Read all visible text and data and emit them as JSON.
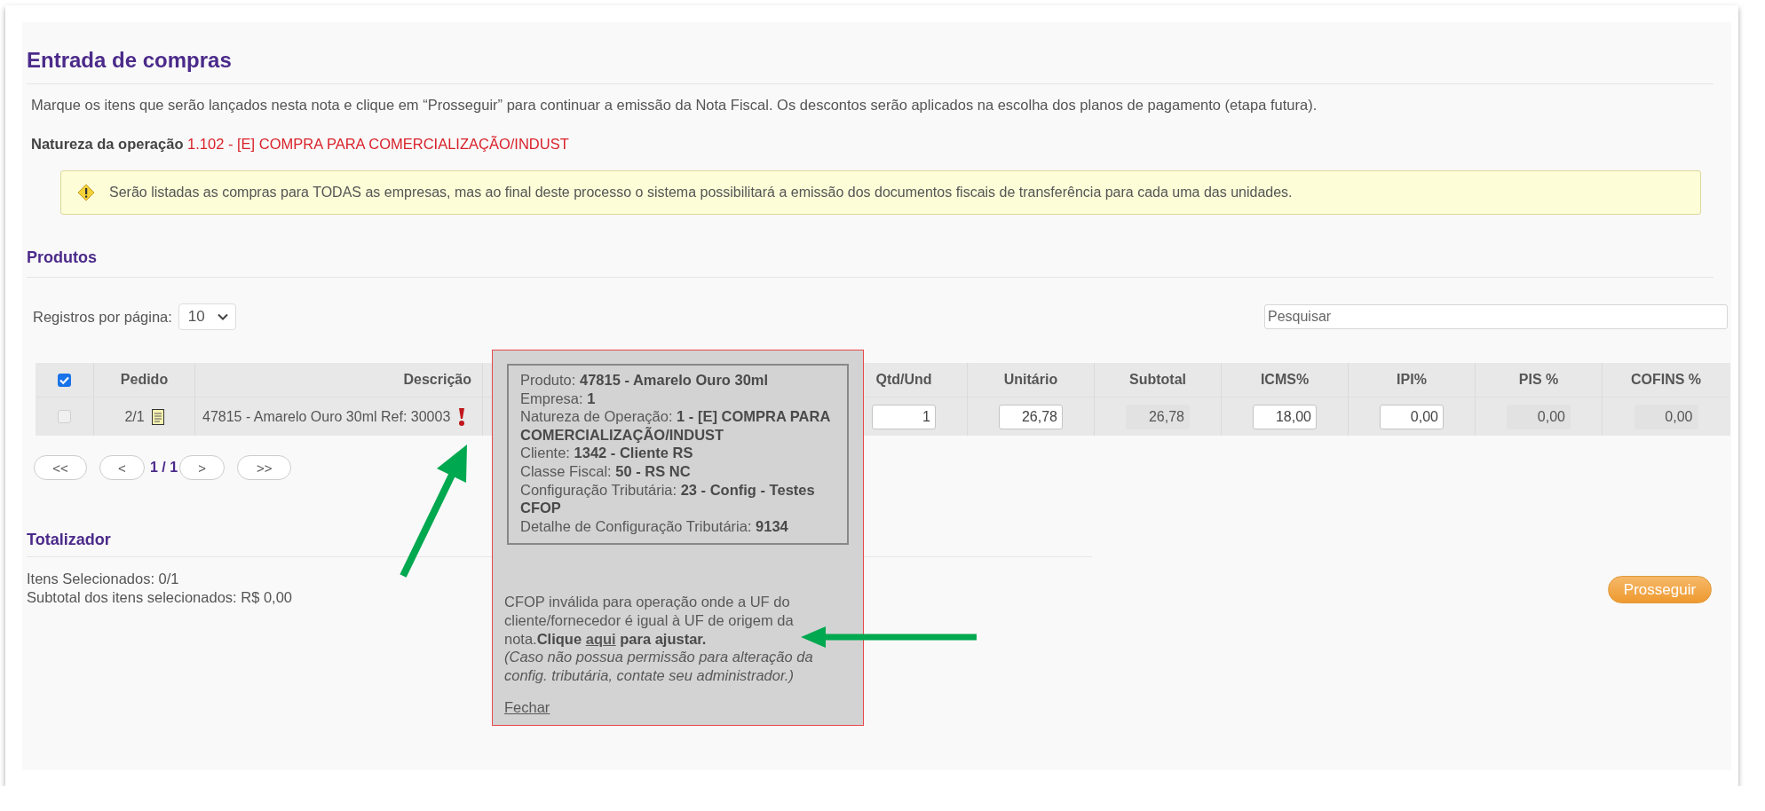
{
  "page": {
    "title": "Entrada de compras",
    "instructions": "Marque os itens que serão lançados nesta nota e clique em “Prosseguir” para continuar a emissão da Nota Fiscal. Os descontos serão aplicados na escolha dos planos de pagamento (etapa futura).",
    "operation": {
      "label": "Natureza da operação",
      "value": "1.102 - [E] COMPRA PARA COMERCIALIZAÇÃO/INDUST"
    },
    "warning": "Serão listadas as compras para TODAS as empresas, mas ao final deste processo o sistema possibilitará a emissão dos documentos fiscais de transferência para cada uma das unidades."
  },
  "products": {
    "heading": "Produtos",
    "page_size": {
      "label": "Registros por página:",
      "value": "10"
    },
    "search": {
      "placeholder": "Pesquisar"
    },
    "table": {
      "select_all": {
        "checked": true
      },
      "columns": [
        "Pedido",
        "Descrição",
        "Qtd/Und",
        "Unitário",
        "Subtotal",
        "ICMS%",
        "IPI%",
        "PIS %",
        "COFINS %"
      ],
      "rows": [
        {
          "checked": false,
          "order": "2/1",
          "description": "47815 - Amarelo Ouro 30ml Ref: 30003",
          "fields": [
            {
              "value": "1",
              "editable": true
            },
            {
              "value": "26,78",
              "editable": true
            },
            {
              "value": "26,78",
              "editable": false
            },
            {
              "value": "18,00",
              "editable": true
            },
            {
              "value": "0,00",
              "editable": true
            },
            {
              "value": "0,00",
              "editable": false
            },
            {
              "value": "0,00",
              "editable": false
            }
          ]
        }
      ]
    },
    "pagination": {
      "first": "<<",
      "prev": "<",
      "current": "1 / 1",
      "next": ">",
      "last": ">>"
    }
  },
  "totals": {
    "heading": "Totalizador",
    "lines": [
      "Itens Selecionados: 0/1",
      "Subtotal dos itens selecionados: R$ 0,00"
    ],
    "proceed_button": "Prosseguir"
  },
  "popup": {
    "details": [
      "Produto: **47815 - Amarelo Ouro 30ml**",
      "Empresa: **1**",
      "Natureza de Operação: **1 - [E] COMPRA PARA COMERCIALIZAÇÃO/INDUST**",
      "Cliente: **1342 - Cliente RS**",
      "Classe Fiscal: **50 - RS NC**",
      "Configuração Tributária: **23 - Config - Testes CFOP**",
      "Detalhe de Configuração Tributária: **9134**"
    ],
    "message": "CFOP inválida para operação onde a UF do cliente/fornecedor é igual à UF de origem da nota.",
    "action": {
      "before": "Clique ",
      "link": "aqui",
      "after": " para ajustar."
    },
    "note": "(Caso não possua permissão para alteração da config. tributária, contate seu administrador.)",
    "close": "Fechar"
  }
}
